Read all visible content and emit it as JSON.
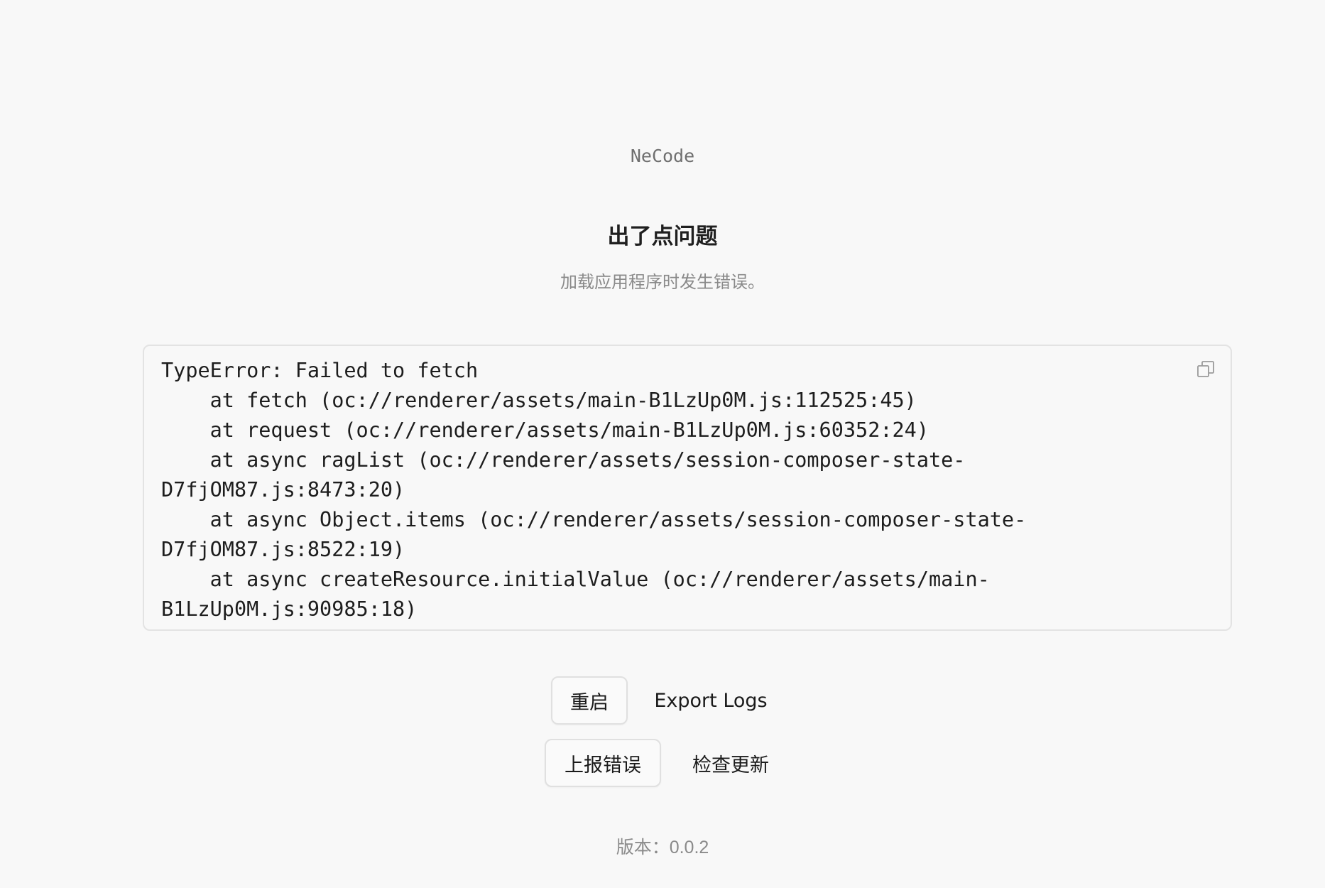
{
  "app": {
    "name": "NeCode"
  },
  "error": {
    "title": "出了点问题",
    "subtitle": "加载应用程序时发生错误。",
    "details": "TypeError: Failed to fetch\n    at fetch (oc://renderer/assets/main-B1LzUp0M.js:112525:45)\n    at request (oc://renderer/assets/main-B1LzUp0M.js:60352:24)\n    at async ragList (oc://renderer/assets/session-composer-state-\nD7fjOM87.js:8473:20)\n    at async Object.items (oc://renderer/assets/session-composer-state-\nD7fjOM87.js:8522:19)\n    at async createResource.initialValue (oc://renderer/assets/main-\nB1LzUp0M.js:90985:18)",
    "copy_icon": "copy-icon"
  },
  "actions": {
    "restart_label": "重启",
    "export_logs_label": "Export Logs",
    "report_error_label": "上报错误",
    "check_update_label": "检查更新"
  },
  "footer": {
    "version_text": "版本：0.0.2"
  },
  "colors": {
    "background": "#f8f8f8",
    "border": "#e3e3e3",
    "text_primary": "#1a1a1a",
    "text_muted": "#8a8a8a"
  }
}
